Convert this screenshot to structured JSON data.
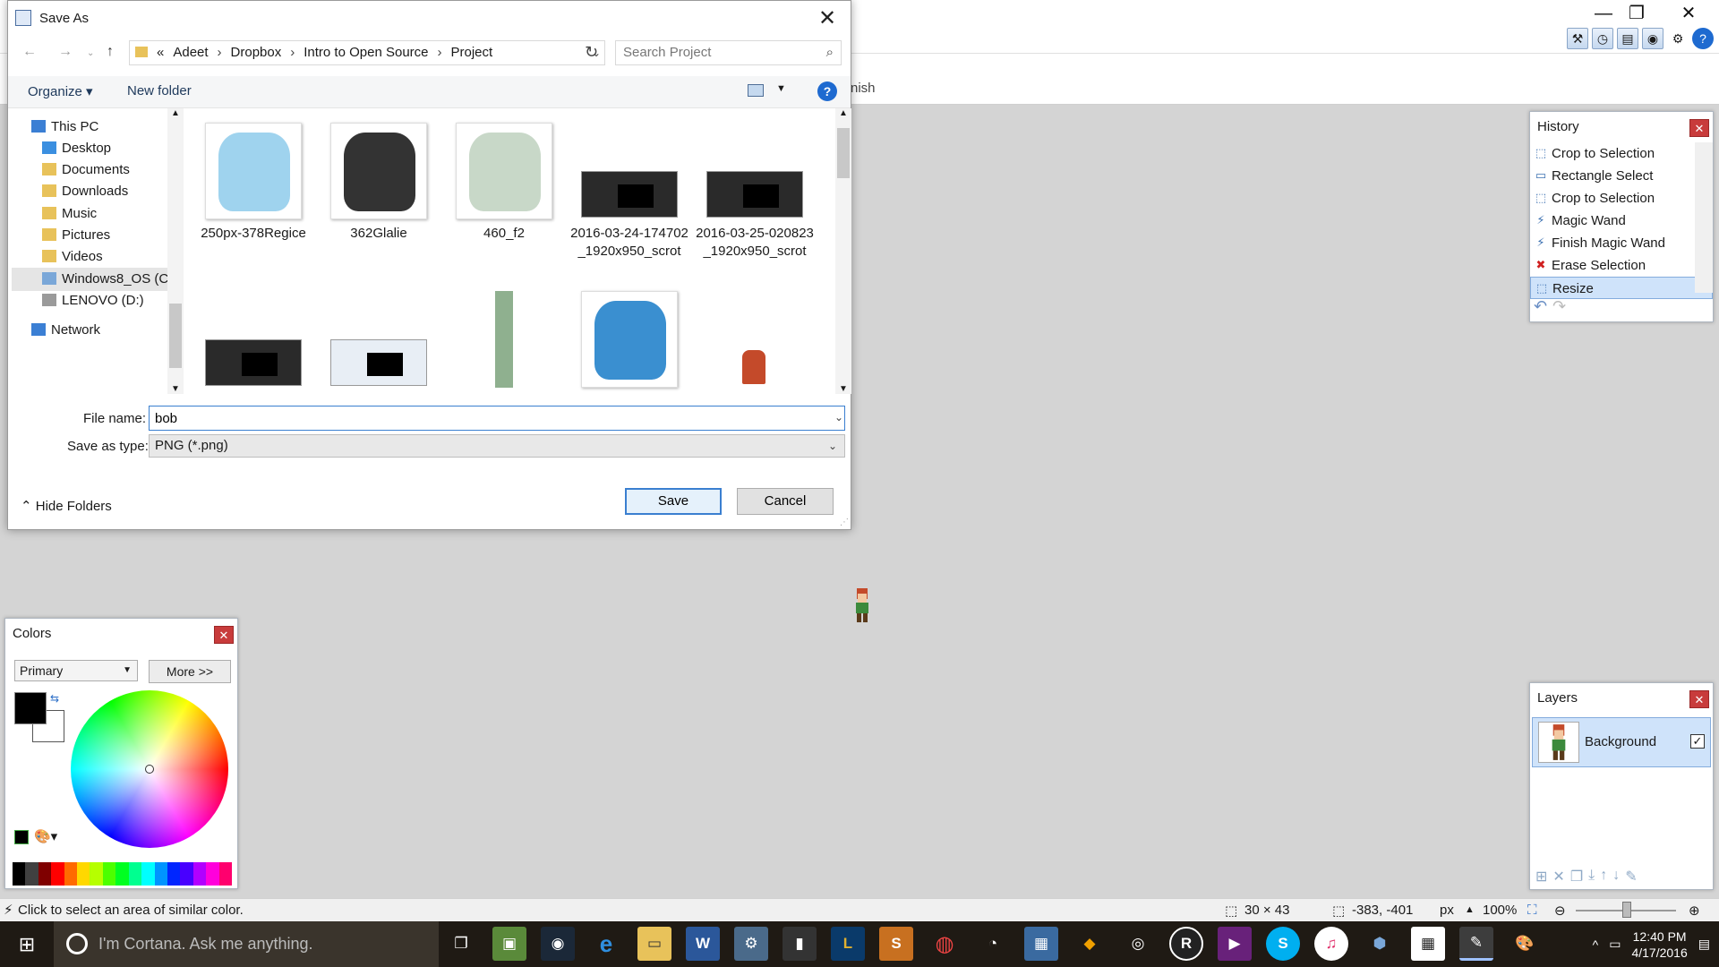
{
  "app": {
    "menu_partial": "nish",
    "window_controls": [
      "restore-icon",
      "maximize-icon",
      "close-icon"
    ],
    "toolbar_icons": [
      "tools-icon",
      "history-icon",
      "layers-icon",
      "colors-icon",
      "settings-icon",
      "help-icon"
    ]
  },
  "dialog": {
    "title": "Save As",
    "close_label": "✕",
    "address": {
      "prefix": "«",
      "crumbs": [
        "Adeet",
        "Dropbox",
        "Intro to Open Source",
        "Project"
      ]
    },
    "search_placeholder": "Search Project",
    "organize_label": "Organize ▾",
    "new_folder_label": "New folder",
    "help_label": "?",
    "nav": [
      {
        "label": "This PC",
        "icon": "computer-icon",
        "color": "#3b7fd4"
      },
      {
        "label": "Desktop",
        "icon": "desktop-icon",
        "color": "#3b8fe0"
      },
      {
        "label": "Documents",
        "icon": "documents-icon",
        "color": "#e8c25a"
      },
      {
        "label": "Downloads",
        "icon": "downloads-icon",
        "color": "#e8c25a"
      },
      {
        "label": "Music",
        "icon": "music-icon",
        "color": "#e8c25a"
      },
      {
        "label": "Pictures",
        "icon": "pictures-icon",
        "color": "#e8c25a"
      },
      {
        "label": "Videos",
        "icon": "videos-icon",
        "color": "#e8c25a"
      },
      {
        "label": "Windows8_OS (C",
        "icon": "drive-icon",
        "color": "#7aa7d8"
      },
      {
        "label": "LENOVO (D:)",
        "icon": "drive-icon",
        "color": "#9a9a9a"
      },
      {
        "label": "Network",
        "icon": "network-icon",
        "color": "#3b7fd4"
      }
    ],
    "files": [
      {
        "name": "250px-378Regice",
        "thumb": "ice-creature",
        "color": "#9fd3ee"
      },
      {
        "name": "362Glalie",
        "thumb": "glalie",
        "color": "#333333"
      },
      {
        "name": "460_f2",
        "thumb": "snow-tree",
        "color": "#c8d8c8"
      },
      {
        "name": "2016-03-24-174702_1920x950_scrot",
        "thumb": "screenshot",
        "color": "#2a2a2a"
      },
      {
        "name": "2016-03-25-020823_1920x950_scrot",
        "thumb": "screenshot",
        "color": "#2a2a2a"
      },
      {
        "name": "",
        "thumb": "screenshot",
        "color": "#2a2a2a"
      },
      {
        "name": "",
        "thumb": "screenshot-light",
        "color": "#e8eef5"
      },
      {
        "name": "",
        "thumb": "sprite-strip",
        "color": "#8fb08f"
      },
      {
        "name": "",
        "thumb": "articuno",
        "color": "#3a8fd0"
      },
      {
        "name": "",
        "thumb": "character-sprite",
        "color": "#c44a2a"
      }
    ],
    "filename_label": "File name:",
    "filename_value": "bob",
    "type_label": "Save as type:",
    "type_value": "PNG (*.png)",
    "hide_folders_label": "Hide Folders",
    "save_label": "Save",
    "cancel_label": "Cancel"
  },
  "history": {
    "title": "History",
    "items": [
      {
        "label": "Crop to Selection",
        "icon": "crop-icon"
      },
      {
        "label": "Rectangle Select",
        "icon": "rectangle-select-icon"
      },
      {
        "label": "Crop to Selection",
        "icon": "crop-icon"
      },
      {
        "label": "Magic Wand",
        "icon": "magic-wand-icon"
      },
      {
        "label": "Finish Magic Wand",
        "icon": "magic-wand-icon"
      },
      {
        "label": "Erase Selection",
        "icon": "erase-icon"
      },
      {
        "label": "Resize",
        "icon": "resize-icon"
      }
    ],
    "selected_index": 6
  },
  "colors": {
    "title": "Colors",
    "mode_value": "Primary",
    "more_label": "More >>",
    "primary_color": "#000000",
    "secondary_color": "#ffffff",
    "palette": [
      "#000000",
      "#404040",
      "#7f0000",
      "#ff0000",
      "#ff6a00",
      "#ffd800",
      "#b6ff00",
      "#4cff00",
      "#00ff21",
      "#00ff90",
      "#00ffff",
      "#0094ff",
      "#0026ff",
      "#4800ff",
      "#b200ff",
      "#ff00dc",
      "#ff006e"
    ]
  },
  "layers": {
    "title": "Layers",
    "items": [
      {
        "label": "Background",
        "visible": true
      }
    ]
  },
  "status": {
    "message": "Click to select an area of similar color.",
    "size": "30 × 43",
    "coords": "-383, -401",
    "unit": "px",
    "zoom": "100%"
  },
  "taskbar": {
    "cortana_placeholder": "I'm Cortana. Ask me anything.",
    "time": "12:40 PM",
    "date": "4/17/2016"
  }
}
